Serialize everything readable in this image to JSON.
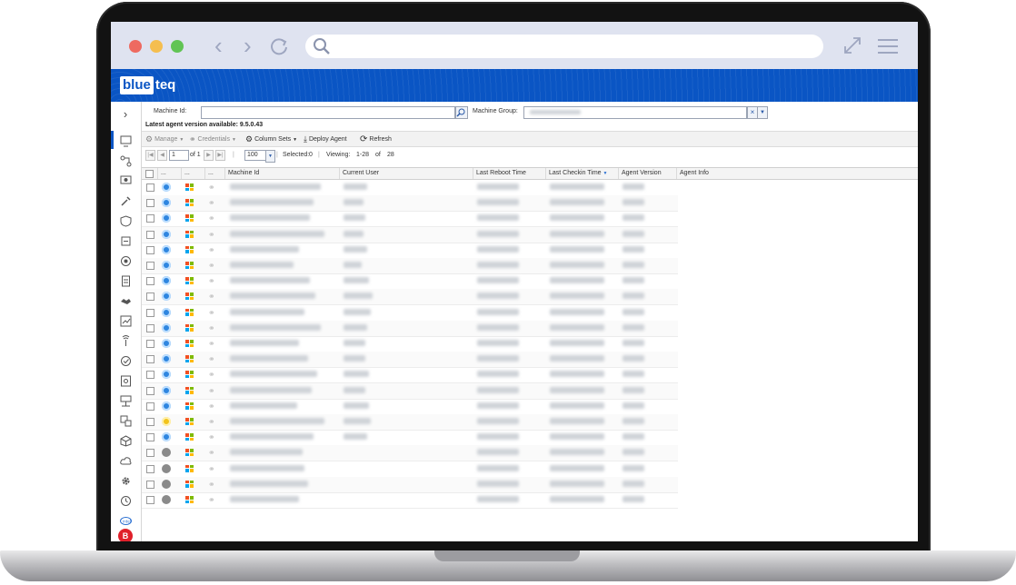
{
  "browser": {
    "traffic_lights": [
      "#ee6a60",
      "#f5be4f",
      "#61c454"
    ],
    "back_icon": "chevron-left-icon",
    "forward_icon": "chevron-right-icon",
    "reload_icon": "reload-icon",
    "search_icon": "search-icon",
    "expand_icon": "expand-icon",
    "menu_icon": "hamburger-menu-icon"
  },
  "app": {
    "logo_part1": "blue",
    "logo_part2": "teq",
    "brand_color": "#0a55c4"
  },
  "filters": {
    "machine_id_label": "Machine Id:",
    "machine_id_value": "",
    "machine_group_label": "Machine Group:"
  },
  "agent_notice": "Latest agent version available: 9.5.0.43",
  "toolbar": {
    "manage": "Manage",
    "credentials": "Credentials",
    "column_sets": "Column Sets",
    "deploy_agent": "Deploy Agent",
    "refresh": "Refresh"
  },
  "pager": {
    "page": "1",
    "of_label": "of 1",
    "page_size": "100",
    "selected_label": "Selected:",
    "selected_value": "0",
    "viewing_label": "Viewing:",
    "viewing_range": "1-28",
    "of_word": "of",
    "total": "28"
  },
  "columns": {
    "c1": "...",
    "c2": "...",
    "c3": "...",
    "machine_id": "Machine Id",
    "current_user": "Current User",
    "last_reboot": "Last Reboot Time",
    "last_checkin": "Last Checkin Time",
    "agent_version": "Agent Version",
    "agent_info": "Agent Info"
  },
  "rows_status": [
    "blue",
    "blue",
    "blue",
    "blue",
    "blue",
    "blue",
    "blue",
    "blue",
    "blue",
    "blue",
    "blue",
    "blue",
    "blue",
    "blue",
    "blue",
    "yellow",
    "blue",
    "grey",
    "grey",
    "grey",
    "grey"
  ],
  "rows_has_user": [
    true,
    true,
    true,
    true,
    true,
    true,
    true,
    true,
    true,
    true,
    true,
    true,
    true,
    true,
    true,
    true,
    true,
    false,
    false,
    false,
    false
  ]
}
